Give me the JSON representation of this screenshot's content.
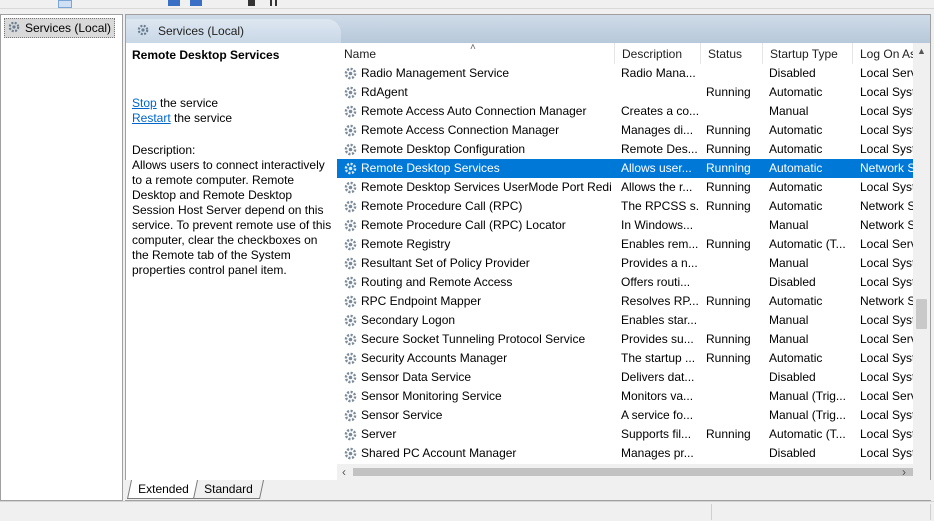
{
  "tree": {
    "root_label": "Services (Local)"
  },
  "header": {
    "title": "Services (Local)"
  },
  "details": {
    "service_title": "Remote Desktop Services",
    "stop_link": "Stop",
    "stop_suffix": " the service",
    "restart_link": "Restart",
    "restart_suffix": " the service",
    "description_label": "Description:",
    "description_text": "Allows users to connect interactively to a remote computer. Remote Desktop and Remote Desktop Session Host Server depend on this service. To prevent remote use of this computer, clear the checkboxes on the Remote tab of the System properties control panel item."
  },
  "columns": {
    "name": "Name",
    "description": "Description",
    "status": "Status",
    "startup_type": "Startup Type",
    "log_on_as": "Log On As"
  },
  "services": [
    {
      "name": "Radio Management Service",
      "description": "Radio Mana...",
      "status": "",
      "startup": "Disabled",
      "logon": "Local Service"
    },
    {
      "name": "RdAgent",
      "description": "",
      "status": "Running",
      "startup": "Automatic",
      "logon": "Local System"
    },
    {
      "name": "Remote Access Auto Connection Manager",
      "description": "Creates a co...",
      "status": "",
      "startup": "Manual",
      "logon": "Local System"
    },
    {
      "name": "Remote Access Connection Manager",
      "description": "Manages di...",
      "status": "Running",
      "startup": "Automatic",
      "logon": "Local System"
    },
    {
      "name": "Remote Desktop Configuration",
      "description": "Remote Des...",
      "status": "Running",
      "startup": "Automatic",
      "logon": "Local System"
    },
    {
      "name": "Remote Desktop Services",
      "description": "Allows user...",
      "status": "Running",
      "startup": "Automatic",
      "logon": "Network Service",
      "selected": true
    },
    {
      "name": "Remote Desktop Services UserMode Port Redi...",
      "description": "Allows the r...",
      "status": "Running",
      "startup": "Automatic",
      "logon": "Local System"
    },
    {
      "name": "Remote Procedure Call (RPC)",
      "description": "The RPCSS s...",
      "status": "Running",
      "startup": "Automatic",
      "logon": "Network Service"
    },
    {
      "name": "Remote Procedure Call (RPC) Locator",
      "description": "In Windows...",
      "status": "",
      "startup": "Manual",
      "logon": "Network Service"
    },
    {
      "name": "Remote Registry",
      "description": "Enables rem...",
      "status": "Running",
      "startup": "Automatic (T...",
      "logon": "Local Service"
    },
    {
      "name": "Resultant Set of Policy Provider",
      "description": "Provides a n...",
      "status": "",
      "startup": "Manual",
      "logon": "Local System"
    },
    {
      "name": "Routing and Remote Access",
      "description": "Offers routi...",
      "status": "",
      "startup": "Disabled",
      "logon": "Local System"
    },
    {
      "name": "RPC Endpoint Mapper",
      "description": "Resolves RP...",
      "status": "Running",
      "startup": "Automatic",
      "logon": "Network Service"
    },
    {
      "name": "Secondary Logon",
      "description": "Enables star...",
      "status": "",
      "startup": "Manual",
      "logon": "Local System"
    },
    {
      "name": "Secure Socket Tunneling Protocol Service",
      "description": "Provides su...",
      "status": "Running",
      "startup": "Manual",
      "logon": "Local Service"
    },
    {
      "name": "Security Accounts Manager",
      "description": "The startup ...",
      "status": "Running",
      "startup": "Automatic",
      "logon": "Local System"
    },
    {
      "name": "Sensor Data Service",
      "description": "Delivers dat...",
      "status": "",
      "startup": "Disabled",
      "logon": "Local System"
    },
    {
      "name": "Sensor Monitoring Service",
      "description": "Monitors va...",
      "status": "",
      "startup": "Manual (Trig...",
      "logon": "Local Service"
    },
    {
      "name": "Sensor Service",
      "description": "A service fo...",
      "status": "",
      "startup": "Manual (Trig...",
      "logon": "Local System"
    },
    {
      "name": "Server",
      "description": "Supports fil...",
      "status": "Running",
      "startup": "Automatic (T...",
      "logon": "Local System"
    },
    {
      "name": "Shared PC Account Manager",
      "description": "Manages pr...",
      "status": "",
      "startup": "Disabled",
      "logon": "Local System"
    }
  ],
  "tabs": {
    "extended": "Extended",
    "standard": "Standard"
  },
  "colors": {
    "selection": "#0078d7",
    "link": "#0066cc"
  },
  "icons": {
    "service": "gear-icon",
    "tree": "services-icon"
  }
}
